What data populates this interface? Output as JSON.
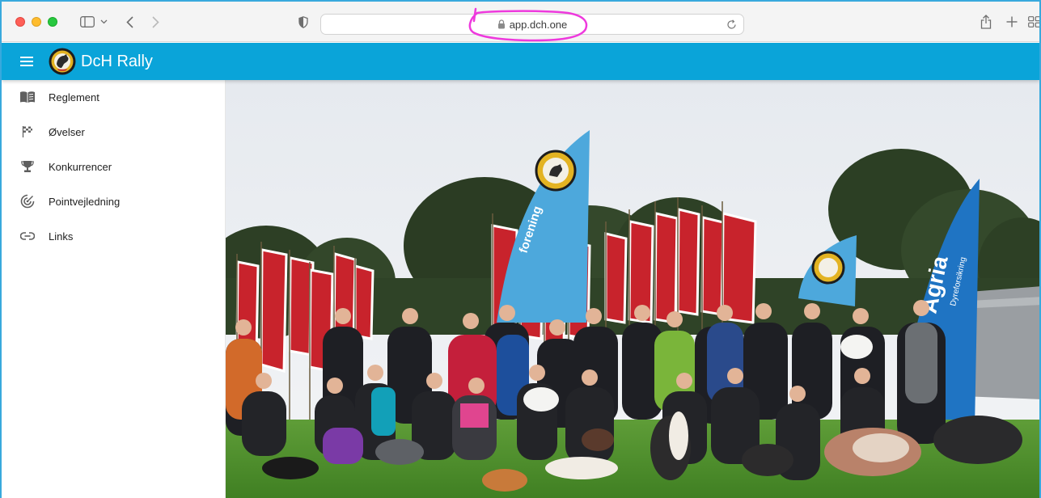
{
  "browser": {
    "url": "app.dch.one",
    "icons": {
      "sidebar": "sidebar-icon",
      "back": "chevron-left-icon",
      "forward": "chevron-right-icon",
      "privacy": "shield-icon",
      "lock": "lock-icon",
      "reload": "reload-icon",
      "share": "share-icon",
      "new_tab": "plus-icon",
      "tab_overview": "grid-icon"
    }
  },
  "app": {
    "title": "DcH Rally",
    "accent_color": "#0aa4d9",
    "logo_icon": "dch-logo"
  },
  "nav": {
    "items": [
      {
        "label": "Reglement",
        "icon": "book-icon"
      },
      {
        "label": "Øvelser",
        "icon": "checkered-flag-icon"
      },
      {
        "label": "Konkurrencer",
        "icon": "trophy-icon"
      },
      {
        "label": "Pointvejledning",
        "icon": "target-icon"
      },
      {
        "label": "Links",
        "icon": "link-icon"
      }
    ]
  },
  "hero": {
    "banner_left_text": "forening",
    "banner_right_brand": "Agria",
    "banner_right_sub": "Dyreforsikring"
  }
}
